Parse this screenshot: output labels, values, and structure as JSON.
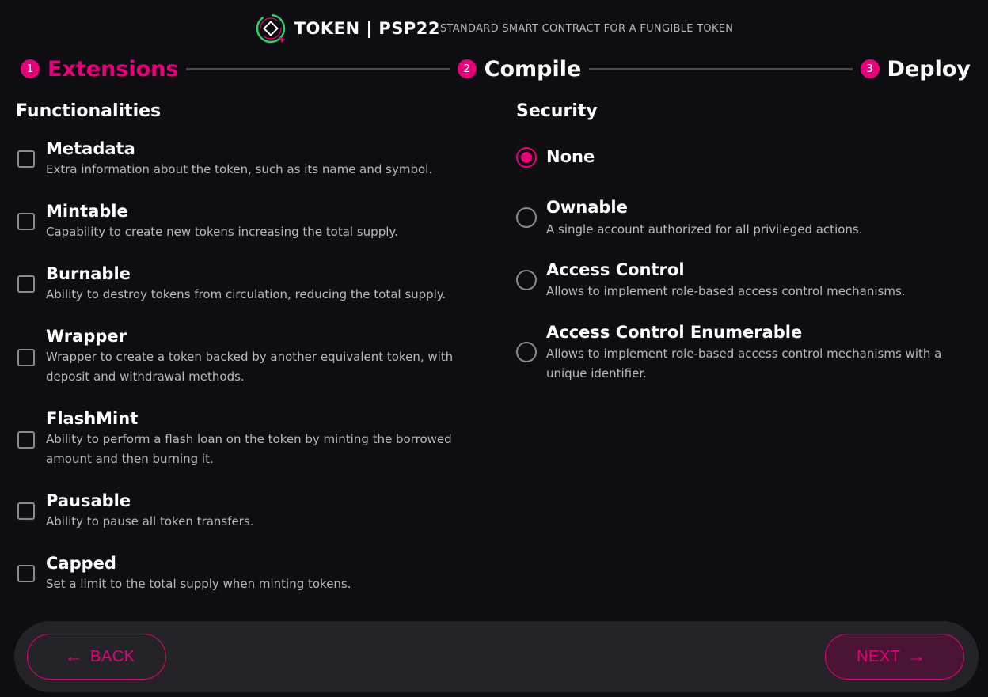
{
  "header": {
    "title": "TOKEN | PSP22",
    "subtitle": "STANDARD SMART CONTRACT FOR A FUNGIBLE TOKEN",
    "logo_icon": "token-logo-icon"
  },
  "stepper": {
    "steps": [
      {
        "number": "1",
        "label": "Extensions",
        "active": true
      },
      {
        "number": "2",
        "label": "Compile",
        "active": false
      },
      {
        "number": "3",
        "label": "Deploy",
        "active": false
      }
    ]
  },
  "functionalities": {
    "title": "Functionalities",
    "items": [
      {
        "title": "Metadata",
        "description": "Extra information about the token, such as its name and symbol.",
        "checked": false
      },
      {
        "title": "Mintable",
        "description": "Capability to create new tokens increasing the total supply.",
        "checked": false
      },
      {
        "title": "Burnable",
        "description": "Ability to destroy tokens from circulation, reducing the total supply.",
        "checked": false
      },
      {
        "title": "Wrapper",
        "description": "Wrapper to create a token backed by another equivalent token, with deposit and withdrawal methods.",
        "checked": false
      },
      {
        "title": "FlashMint",
        "description": "Ability to perform a flash loan on the token by minting the borrowed amount and then burning it.",
        "checked": false
      },
      {
        "title": "Pausable",
        "description": "Ability to pause all token transfers.",
        "checked": false
      },
      {
        "title": "Capped",
        "description": "Set a limit to the total supply when minting tokens.",
        "checked": false
      }
    ]
  },
  "security": {
    "title": "Security",
    "items": [
      {
        "title": "None",
        "description": "",
        "selected": true
      },
      {
        "title": "Ownable",
        "description": "A single account authorized for all privileged actions.",
        "selected": false
      },
      {
        "title": "Access Control",
        "description": "Allows to implement role-based access control mechanisms.",
        "selected": false
      },
      {
        "title": "Access Control Enumerable",
        "description": "Allows to implement role-based access control mechanisms with a unique identifier.",
        "selected": false
      }
    ]
  },
  "footer": {
    "back_label": "BACK",
    "next_label": "NEXT",
    "back_icon": "arrow-left-icon",
    "next_icon": "arrow-right-icon"
  },
  "colors": {
    "accent": "#e6007a",
    "background": "#0d0d12",
    "footer_bg": "#242428",
    "muted_text": "#b8b8c0"
  }
}
